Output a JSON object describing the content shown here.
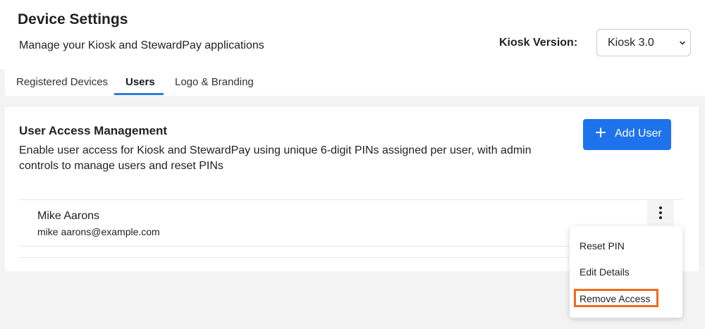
{
  "header": {
    "title": "Device Settings",
    "subtitle": "Manage your Kiosk and StewardPay applications",
    "version_label": "Kiosk Version:",
    "version_value": "Kiosk 3.0"
  },
  "tabs": [
    {
      "label": "Registered Devices",
      "active": false
    },
    {
      "label": "Users",
      "active": true
    },
    {
      "label": "Logo & Branding",
      "active": false
    }
  ],
  "card": {
    "title": "User Access Management",
    "description": "Enable user access for Kiosk and StewardPay using unique 6-digit PINs assigned per user, with admin controls to manage users and reset PINs",
    "add_user_label": "Add User"
  },
  "users": [
    {
      "name": "Mike Aarons",
      "email": "mike aarons@example.com"
    }
  ],
  "context_menu": {
    "items": [
      "Reset PIN",
      "Edit Details",
      "Remove Access"
    ]
  },
  "colors": {
    "accent": "#1e73ec",
    "tab_underline": "#2f7bdc",
    "highlight": "#f26a1b"
  },
  "icons": {
    "add": "plus-icon",
    "menu": "kebab-menu-icon",
    "select": "chevron-updown-icon"
  }
}
